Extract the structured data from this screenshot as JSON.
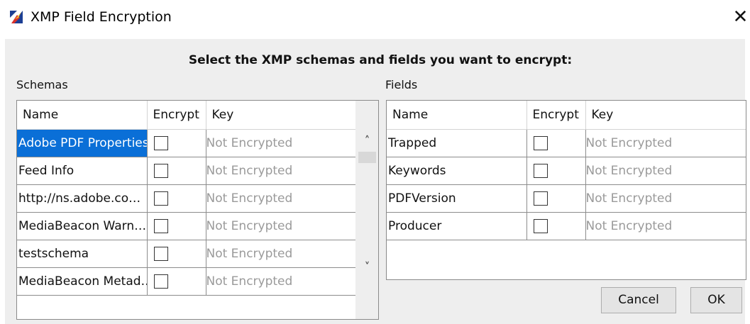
{
  "window": {
    "title": "XMP Field Encryption",
    "app_icon": "app-icon",
    "close_glyph": "✕"
  },
  "dialog": {
    "heading": "Select the XMP schemas and fields you want to encrypt:",
    "schemas_label": "Schemas",
    "fields_label": "Fields"
  },
  "schemas_table": {
    "columns": [
      "Name",
      "Encrypt",
      "Key"
    ],
    "rows": [
      {
        "name": "Adobe PDF Properties",
        "encrypt": false,
        "key": "Not Encrypted",
        "selected": true
      },
      {
        "name": "Feed Info",
        "encrypt": false,
        "key": "Not Encrypted"
      },
      {
        "name": "http://ns.adobe.co…",
        "encrypt": false,
        "key": "Not Encrypted"
      },
      {
        "name": "MediaBeacon Warn…",
        "encrypt": false,
        "key": "Not Encrypted"
      },
      {
        "name": "testschema",
        "encrypt": false,
        "key": "Not Encrypted"
      },
      {
        "name": "MediaBeacon Metad…",
        "encrypt": false,
        "key": "Not Encrypted"
      }
    ]
  },
  "fields_table": {
    "columns": [
      "Name",
      "Encrypt",
      "Key"
    ],
    "rows": [
      {
        "name": "Trapped",
        "encrypt": false,
        "key": "Not Encrypted"
      },
      {
        "name": "Keywords",
        "encrypt": false,
        "key": "Not Encrypted"
      },
      {
        "name": "PDFVersion",
        "encrypt": false,
        "key": "Not Encrypted"
      },
      {
        "name": "Producer",
        "encrypt": false,
        "key": "Not Encrypted"
      }
    ]
  },
  "scrollbar": {
    "up_glyph": "˄",
    "down_glyph": "˅"
  },
  "buttons": {
    "cancel": "Cancel",
    "ok": "OK"
  },
  "colors": {
    "selection": "#0a6fd7",
    "key_text": "#9a9a9a",
    "dialog_bg": "#eeeeee"
  }
}
